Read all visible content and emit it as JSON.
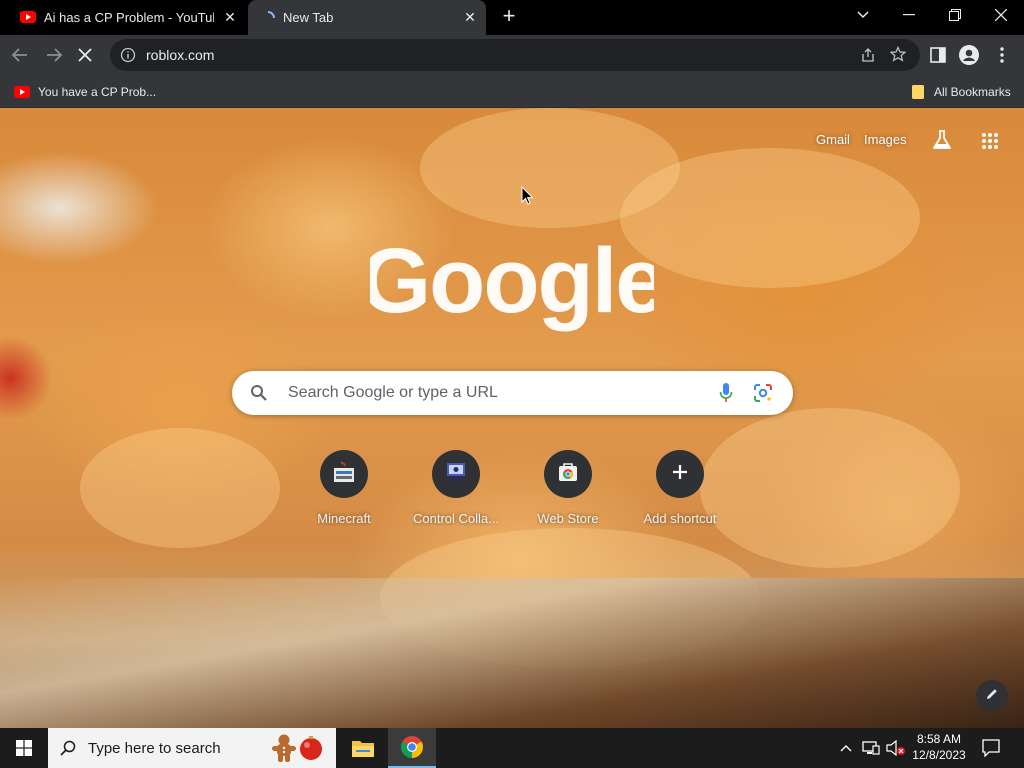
{
  "browser": {
    "tabs": [
      {
        "title": "Ai has a CP Problem - YouTube",
        "favicon": "youtube-icon",
        "active": false
      },
      {
        "title": "New Tab",
        "favicon": "loading-spinner-icon",
        "active": true
      }
    ],
    "address": "roblox.com",
    "bookmarks": [
      {
        "label": "You have a CP Prob...",
        "icon": "youtube-icon"
      },
      {
        "label": "All Bookmarks",
        "icon": "folder-icon"
      }
    ]
  },
  "ntp": {
    "top_links": {
      "gmail": "Gmail",
      "images": "Images"
    },
    "search_placeholder": "Search Google or type a URL",
    "shortcuts": [
      {
        "label": "Minecraft",
        "icon": "minecraft-icon"
      },
      {
        "label": "Control Colla...",
        "icon": "control-collaboration-icon"
      },
      {
        "label": "Web Store",
        "icon": "web-store-icon"
      },
      {
        "label": "Add shortcut",
        "icon": "plus-icon"
      }
    ]
  },
  "taskbar": {
    "search_placeholder": "Type here to search",
    "time": "8:58 AM",
    "date": "12/8/2023"
  },
  "colors": {
    "tab_strip": "#000000",
    "toolbar": "#35363a",
    "omnibox": "#202124",
    "taskbar": "#1c1c1c",
    "chrome_blue_accent": "#4285f4"
  }
}
